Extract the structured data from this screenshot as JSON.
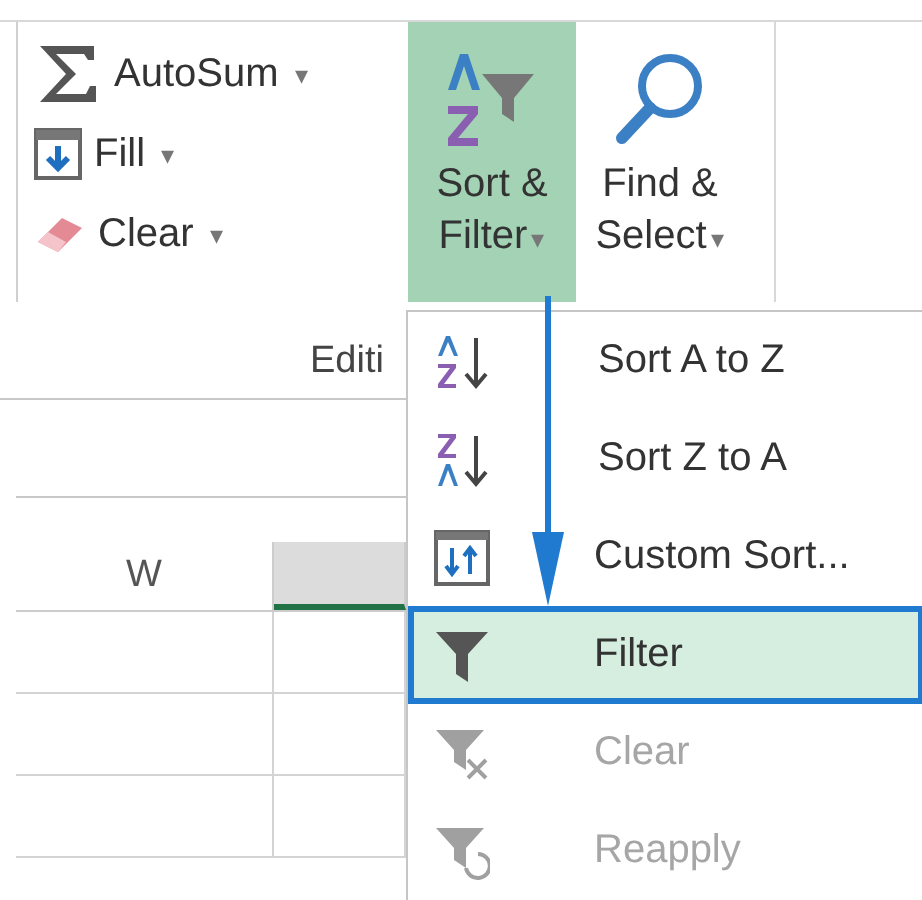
{
  "ribbon": {
    "small_buttons": [
      {
        "kind": "sum",
        "label": "AutoSum",
        "dropdown": "▾"
      },
      {
        "kind": "fill",
        "label": "Fill",
        "dropdown": "▾"
      },
      {
        "kind": "eraser",
        "label": "Clear",
        "dropdown": "▾"
      }
    ],
    "large_buttons": [
      {
        "kind": "sort",
        "lines": [
          "Sort &",
          "Filter"
        ],
        "dropdown": "▾",
        "selected": true
      },
      {
        "kind": "find",
        "lines": [
          "Find &",
          "Select"
        ],
        "dropdown": "▾",
        "selected": false
      }
    ],
    "group_label": "Editi"
  },
  "sheet": {
    "columns": [
      {
        "label": "W",
        "selected": false
      },
      {
        "selected": true
      }
    ]
  },
  "menu": {
    "items": [
      {
        "kind": "az",
        "label": "Sort A to Z",
        "selected": false,
        "disabled": false
      },
      {
        "kind": "za",
        "label": "Sort Z to A",
        "selected": false,
        "disabled": false
      },
      {
        "kind": "custom",
        "label": "Custom Sort...",
        "selected": false,
        "disabled": false
      },
      {
        "kind": "filter",
        "label": "Filter",
        "selected": true,
        "disabled": false
      },
      {
        "kind": "clear",
        "label": "Clear",
        "selected": false,
        "disabled": true
      },
      {
        "kind": "reapply",
        "label": "Reapply",
        "selected": false,
        "disabled": true
      }
    ]
  }
}
